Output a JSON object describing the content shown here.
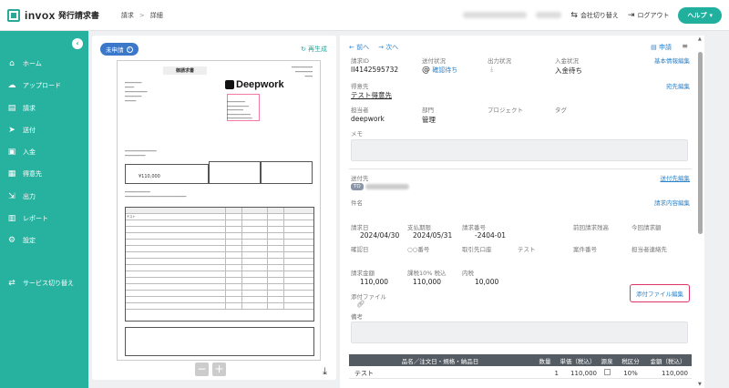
{
  "app": {
    "name": "invox",
    "subtitle": "発行請求書",
    "breadcrumb": [
      "請求",
      "詳細"
    ],
    "breadcrumb_sep": ">"
  },
  "header": {
    "switch_company": "会社切り替え",
    "logout": "ログアウト",
    "help": "ヘルプ"
  },
  "sidebar": {
    "items": [
      {
        "label": "ホーム",
        "icon": "home-icon"
      },
      {
        "label": "アップロード",
        "icon": "upload-icon"
      },
      {
        "label": "請求",
        "icon": "invoice-icon"
      },
      {
        "label": "送付",
        "icon": "send-icon"
      },
      {
        "label": "入金",
        "icon": "payment-icon"
      },
      {
        "label": "得意先",
        "icon": "customer-icon"
      },
      {
        "label": "出力",
        "icon": "output-icon"
      },
      {
        "label": "レポート",
        "icon": "report-icon"
      },
      {
        "label": "設定",
        "icon": "settings-icon"
      }
    ],
    "switch_service": "サービス切り替え"
  },
  "preview": {
    "status": "未申請",
    "regenerate": "再生成",
    "doc_title": "御請求書",
    "doc_company": "Deepwork",
    "doc_amount": "¥110,000",
    "doc_item": "テスト"
  },
  "detail": {
    "prev": "前へ",
    "next": "次へ",
    "apply": "申請",
    "invoice_id_label": "請求ID",
    "invoice_id": "II4142595732",
    "send_status_label": "送付状況",
    "send_status": "確認待ち",
    "output_status_label": "出力状況",
    "payment_status_label": "入金状況",
    "payment_status": "入金待ち",
    "edit_basic": "基本情報編集",
    "customer_label": "得意先",
    "customer": "テスト得意先",
    "edit_recipient": "宛先編集",
    "owner_label": "担当者",
    "owner": "deepwork",
    "dept_label": "部門",
    "dept": "管理",
    "project_label": "プロジェクト",
    "tag_label": "タグ",
    "memo_label": "メモ",
    "send_to_label": "送付先",
    "edit_send_to": "送付先編集",
    "send_to_chip": "TO",
    "subject_label": "件名",
    "edit_content": "請求内容編集",
    "invoice_date_label": "請求日",
    "invoice_date": "2024/04/30",
    "due_date_label": "支払期限",
    "due_date": "2024/05/31",
    "invoice_no_label": "請求番号",
    "invoice_no": "-2404-01",
    "prev_balance_label": "前回請求残高",
    "current_amount_label": "今回請求額",
    "confirm_date_label": "確認日",
    "oo_no_label": "○○番号",
    "bank_label": "取引先口座",
    "test_label": "テスト",
    "case_no_label": "案件番号",
    "contact_label": "担当者連絡先",
    "amount_label": "請求金額",
    "amount": "110,000",
    "taxed_label": "課税10% 税込",
    "taxed": "110,000",
    "tax_label": "内税",
    "tax": "10,000",
    "attach_label": "添付ファイル",
    "edit_attach": "添付ファイル編集",
    "remarks_label": "備考"
  },
  "items_table": {
    "headers": [
      "品名／注文日・規格・納品日",
      "数量",
      "単価（税込）",
      "源泉",
      "税区分",
      "金額（税込）"
    ],
    "rows": [
      {
        "name": "テスト",
        "qty": "1",
        "price": "110,000",
        "tax": "10%",
        "amount": "110,000"
      }
    ]
  }
}
